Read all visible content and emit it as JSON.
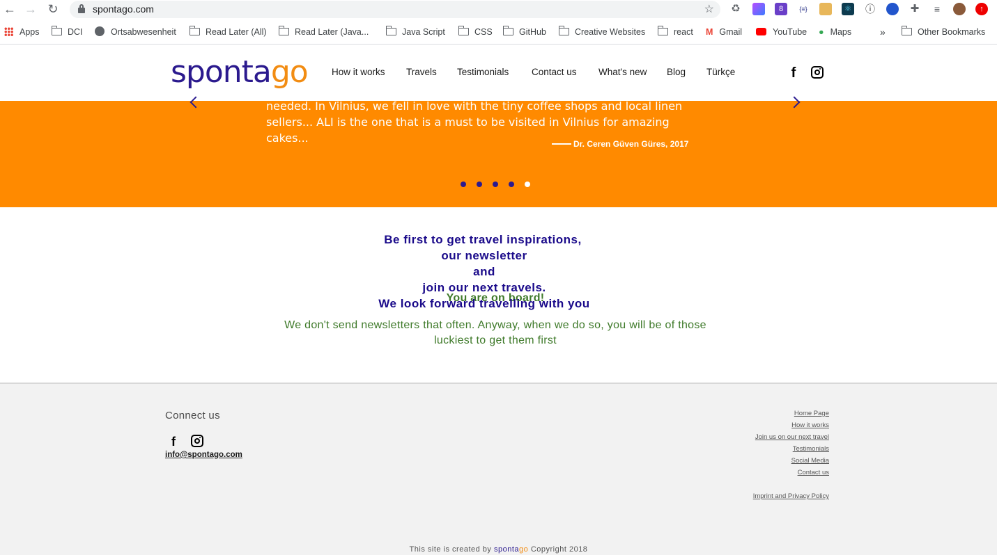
{
  "browser": {
    "url": "spontago.com",
    "bookmarks": [
      "Apps",
      "DCI",
      "Ortsabwesenheit",
      "Read Later (All)",
      "Read Later (Java...",
      "Java Script",
      "CSS",
      "GitHub",
      "Creative Websites",
      "react",
      "Gmail",
      "YouTube",
      "Maps",
      "Other Bookmarks"
    ],
    "overflow": "»"
  },
  "header": {
    "logo_part1": "sponta",
    "logo_part2": "go",
    "menu": [
      "How it works",
      "Travels",
      "Testimonials",
      "Contact us",
      "What's new",
      "Blog",
      "Türkçe"
    ]
  },
  "testimonial": {
    "text": "needed.  In Vilnius, we fell in love with the tiny coffee shops and local linen sellers... ALI is the one that is a must to be visited in Vilnius for amazing cakes...",
    "author": "Dr. Ceren Güven Güres, 2017",
    "slide_count": 5,
    "active_slide": 5
  },
  "newsletter": {
    "line1": "Be first to get travel inspirations,",
    "line2": "our newsletter",
    "line3": "and",
    "line4": "join our next travels.",
    "line5": "We look forward travelling with you",
    "on_board": "You are on board!",
    "note": "We don't send newsletters that often. Anyway, when we do so, you will be of those luckiest to get them first"
  },
  "footer": {
    "connect_title": "Connect us",
    "email": "info@spontago.com",
    "links": [
      "Home Page",
      "How it works",
      "Join us on our next travel",
      "Testimonials",
      "Social Media",
      "Contact us"
    ],
    "legal": "Imprint and Privacy Policy ",
    "credit_prefix": "This site is created by ",
    "credit_brand1": "sponta",
    "credit_brand2": "go",
    "credit_suffix": " Copyright 2018"
  }
}
